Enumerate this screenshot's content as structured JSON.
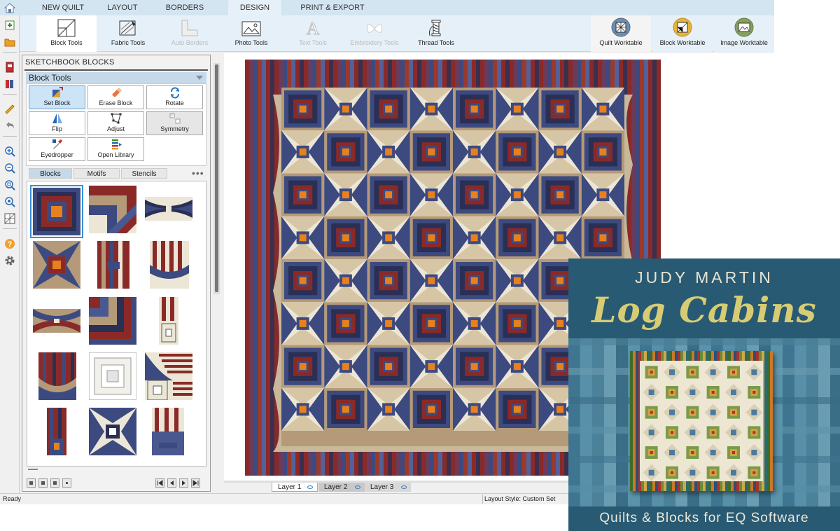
{
  "tabs": [
    "NEW QUILT",
    "LAYOUT",
    "BORDERS",
    "DESIGN",
    "PRINT & EXPORT"
  ],
  "active_tab": "DESIGN",
  "ribbon": {
    "block_tools": "Block Tools",
    "fabric_tools": "Fabric Tools",
    "auto_borders": "Auto Borders",
    "photo_tools": "Photo Tools",
    "text_tools": "Text Tools",
    "embroidery_tools": "Embroidery Tools",
    "thread_tools": "Thread Tools",
    "quilt_worktable": "Quilt Worktable",
    "block_worktable": "Block Worktable",
    "image_worktable": "Image Worktable"
  },
  "left_toolbar_icons": [
    "add-block-icon",
    "open-folder-icon",
    "sketchbook-icon",
    "library-icon",
    "ruler-icon",
    "undo-icon",
    "zoom-in-icon",
    "zoom-out-icon",
    "zoom-fit-icon",
    "zoom-all-icon",
    "grid-icon",
    "help-icon",
    "settings-icon"
  ],
  "panel": {
    "title": "SKETCHBOOK BLOCKS",
    "section": "Block Tools",
    "tools": {
      "set_block": "Set Block",
      "erase_block": "Erase Block",
      "rotate": "Rotate",
      "flip": "Flip",
      "adjust": "Adjust",
      "symmetry": "Symmetry",
      "eyedropper": "Eyedropper",
      "open_library": "Open Library"
    },
    "subtabs": [
      "Blocks",
      "Motifs",
      "Stencils"
    ],
    "active_subtab": "Blocks",
    "more": "•••"
  },
  "layers": {
    "layer1": "Layer 1",
    "layer2": "Layer 2",
    "layer3": "Layer 3"
  },
  "status": {
    "ready": "Ready",
    "layout_style": "Layout Style: Custom Set"
  },
  "book": {
    "author": "JUDY MARTIN",
    "title": "Log Cabins",
    "subtitle": "Quilts & Blocks for EQ Software"
  },
  "colors": {
    "navy": "#3d4a80",
    "red": "#8a2a28",
    "tan": "#b49a78",
    "cream": "#ece6d6",
    "orange": "#e8801e",
    "tab_bar": "#d4e5f2",
    "ribbon": "#e6f0f8",
    "book_teal": "#4b7f97"
  }
}
